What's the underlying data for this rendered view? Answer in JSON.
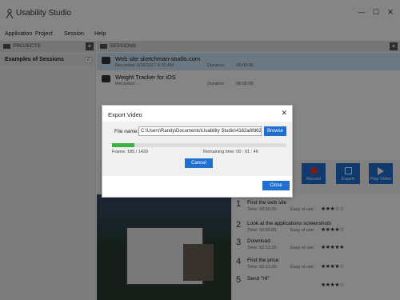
{
  "window": {
    "title": "Usability Studio",
    "minimize": "—",
    "maximize": "☐",
    "close": "✕"
  },
  "menu": [
    "Application",
    "Project",
    "Session",
    "Help"
  ],
  "projects": {
    "header": "PROJECTS",
    "add": "+",
    "items": [
      {
        "name": "Examples of Sessions",
        "count": "2"
      }
    ]
  },
  "sessions": {
    "header": "SESSIONS",
    "add": "+",
    "items": [
      {
        "name": "Web site sketchman-studio.com",
        "meta": "Recorded:   6/26/2017 9:25 AM",
        "duration_label": "Duration:",
        "duration": "00:00:06"
      },
      {
        "name": "Weight Tracker for iOS",
        "meta": "Recorded:   -",
        "duration_label": "Duration:",
        "duration": "00:00:00"
      }
    ]
  },
  "actions": {
    "record": "Record",
    "export": "Export",
    "play": "Play Video"
  },
  "background": {
    "ex1": "Ex",
    "ex2": "W"
  },
  "tasks": [
    {
      "num": "1",
      "name": "Find the web site",
      "time": "Time: 00:50.00",
      "ease": "Easy of use:",
      "stars": "★★★☆☆"
    },
    {
      "num": "2",
      "name": "Look at the applications screenshots",
      "time": "Time: 03:20.00",
      "ease": "Easy of use:",
      "stars": "★★★★☆"
    },
    {
      "num": "3",
      "name": "Download",
      "time": "Time: 02:13.20",
      "ease": "Easy of use:",
      "stars": "★★★★★"
    },
    {
      "num": "4",
      "name": "Find the price",
      "time": "Time: 02:13.20",
      "ease": "Easy of use:",
      "stars": "★★★★☆"
    },
    {
      "num": "5",
      "name": "Send \"Hi\"",
      "time": "",
      "ease": "",
      "stars": "★★★★☆"
    }
  ],
  "dialog": {
    "title": "Export Video",
    "close_glyph": "✕",
    "file_label": "File name:",
    "file_value": "C:\\Users\\Randy\\Documents\\Usability Studio\\4162a8fd62",
    "browse": "Browse",
    "progress": 0.13,
    "frame": "Frame: 185 / 1429",
    "remaining": "Remaining time: 00 : 01 : 46",
    "cancel": "Cancel",
    "close": "Close"
  },
  "colors": {
    "accent": "#1f6fd1",
    "progress": "#3cb043",
    "selected_row": "#cde6f7"
  }
}
